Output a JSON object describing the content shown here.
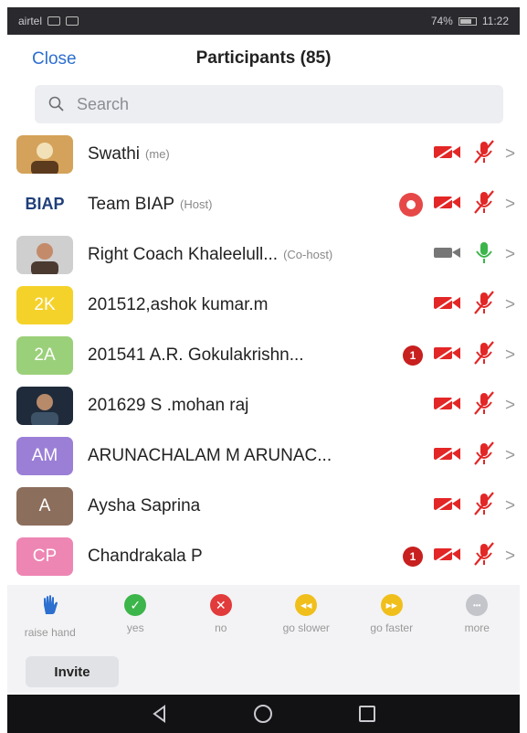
{
  "status_bar": {
    "carrier": "airtel",
    "battery": "74%",
    "time": "11:22"
  },
  "header": {
    "close_label": "Close",
    "title": "Participants (85)"
  },
  "search": {
    "placeholder": "Search"
  },
  "participants": [
    {
      "name": "Swathi",
      "role": "(me)",
      "avatar_type": "photo",
      "video": "off",
      "mic": "muted"
    },
    {
      "name": "Team BIAP",
      "role": "(Host)",
      "avatar_type": "logo",
      "avatar_text": "BIAP",
      "recording": true,
      "video": "off",
      "mic": "muted"
    },
    {
      "name": "Right Coach Khaleelull...",
      "role": "(Co-host)",
      "avatar_type": "photo",
      "video": "on",
      "mic": "on"
    },
    {
      "name": "201512,ashok kumar.m",
      "role": "",
      "avatar_type": "initials",
      "avatar_text": "2K",
      "avatar_color": "#f5d22a",
      "video": "off",
      "mic": "muted"
    },
    {
      "name": "201541 A.R. Gokulakrishn...",
      "role": "",
      "avatar_type": "initials",
      "avatar_text": "2A",
      "avatar_color": "#9bd07a",
      "badge": "1",
      "video": "off",
      "mic": "muted"
    },
    {
      "name": "201629 S .mohan raj",
      "role": "",
      "avatar_type": "photo",
      "video": "off",
      "mic": "muted"
    },
    {
      "name": "ARUNACHALAM M ARUNAC...",
      "role": "",
      "avatar_type": "initials",
      "avatar_text": "AM",
      "avatar_color": "#9b7fd6",
      "video": "off",
      "mic": "muted"
    },
    {
      "name": "Aysha Saprina",
      "role": "",
      "avatar_type": "initials",
      "avatar_text": "A",
      "avatar_color": "#8c6e5c",
      "video": "off",
      "mic": "muted"
    },
    {
      "name": "Chandrakala P",
      "role": "",
      "avatar_type": "initials",
      "avatar_text": "CP",
      "avatar_color": "#ee86b4",
      "badge": "1",
      "video": "off",
      "mic": "muted"
    }
  ],
  "reactions": [
    {
      "label": "raise hand",
      "icon": "hand-icon",
      "color": "#2d6fcf"
    },
    {
      "label": "yes",
      "icon": "check-icon",
      "color": "#3cb54a"
    },
    {
      "label": "no",
      "icon": "x-icon",
      "color": "#e23b3b"
    },
    {
      "label": "go slower",
      "icon": "rewind-icon",
      "color": "#f0bf1c"
    },
    {
      "label": "go faster",
      "icon": "fast-forward-icon",
      "color": "#f0bf1c"
    },
    {
      "label": "more",
      "icon": "more-icon",
      "color": "#c3c5ca"
    }
  ],
  "footer": {
    "invite_label": "Invite"
  },
  "colors": {
    "accent": "#2d6fcf",
    "muted_red": "#e32626",
    "mic_on": "#3cb54a",
    "video_on": "#777777"
  }
}
